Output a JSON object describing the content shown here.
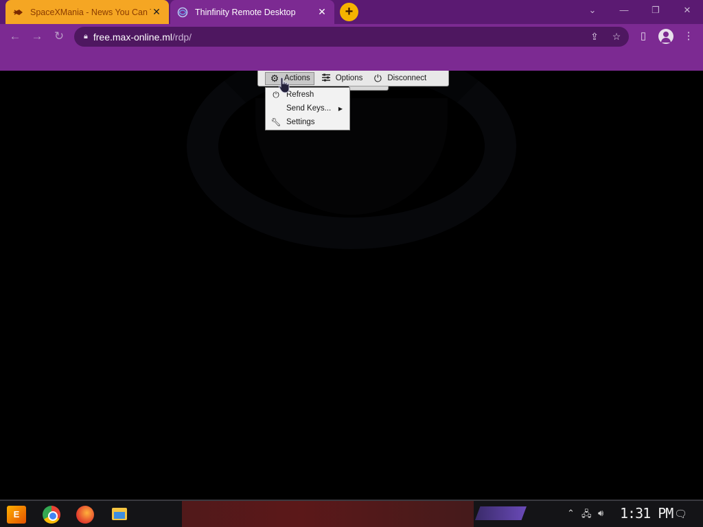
{
  "browser": {
    "tabs": [
      {
        "title": "SpaceXMania - News You Can T",
        "close": "✕"
      },
      {
        "title": "Thinfinity Remote Desktop",
        "close": "✕"
      }
    ],
    "new_tab": "+",
    "window_controls": {
      "tab_list": "⌄",
      "minimize": "—",
      "restore": "❐",
      "close": "✕"
    },
    "address": {
      "host": "free.max-online.ml",
      "path": "/rdp/"
    }
  },
  "rdp_toolbar": {
    "actions": "Actions",
    "options": "Options",
    "disconnect": "Disconnect"
  },
  "actions_menu": {
    "items": [
      {
        "label": "Refresh"
      },
      {
        "label": "Send Keys..."
      },
      {
        "label": "Settings"
      }
    ]
  },
  "taskbar": {
    "start_label": "E",
    "clock": "1:31 PM"
  },
  "colors": {
    "browser_frame": "#7c2a92",
    "active_tab": "#f5a623",
    "remote_bg": "#000000"
  }
}
